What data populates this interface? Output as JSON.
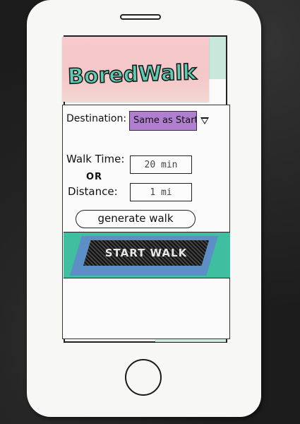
{
  "app": {
    "logo_text": "BoredWalk"
  },
  "form": {
    "destination_label": "Destination:",
    "destination_value": "Same as Start",
    "walk_time_label": "Walk Time:",
    "or_label": "OR",
    "distance_label": "Distance:",
    "walk_time_value": "20 min",
    "distance_value": "1 mi",
    "generate_label": "generate walk"
  },
  "actions": {
    "start_walk_label": "START WALK"
  },
  "colors": {
    "header_pink": "#f6c9cc",
    "logo_teal": "#5bcfb4",
    "dropdown_purple": "#b07fd0",
    "banner_teal": "#3fbfa0",
    "banner_blue": "#5b8fc6",
    "start_button_dark": "#1b1b1b"
  },
  "icons": {
    "dropdown": "chevron-down-icon",
    "home": "home-button-icon",
    "speaker": "speaker-slot-icon"
  }
}
